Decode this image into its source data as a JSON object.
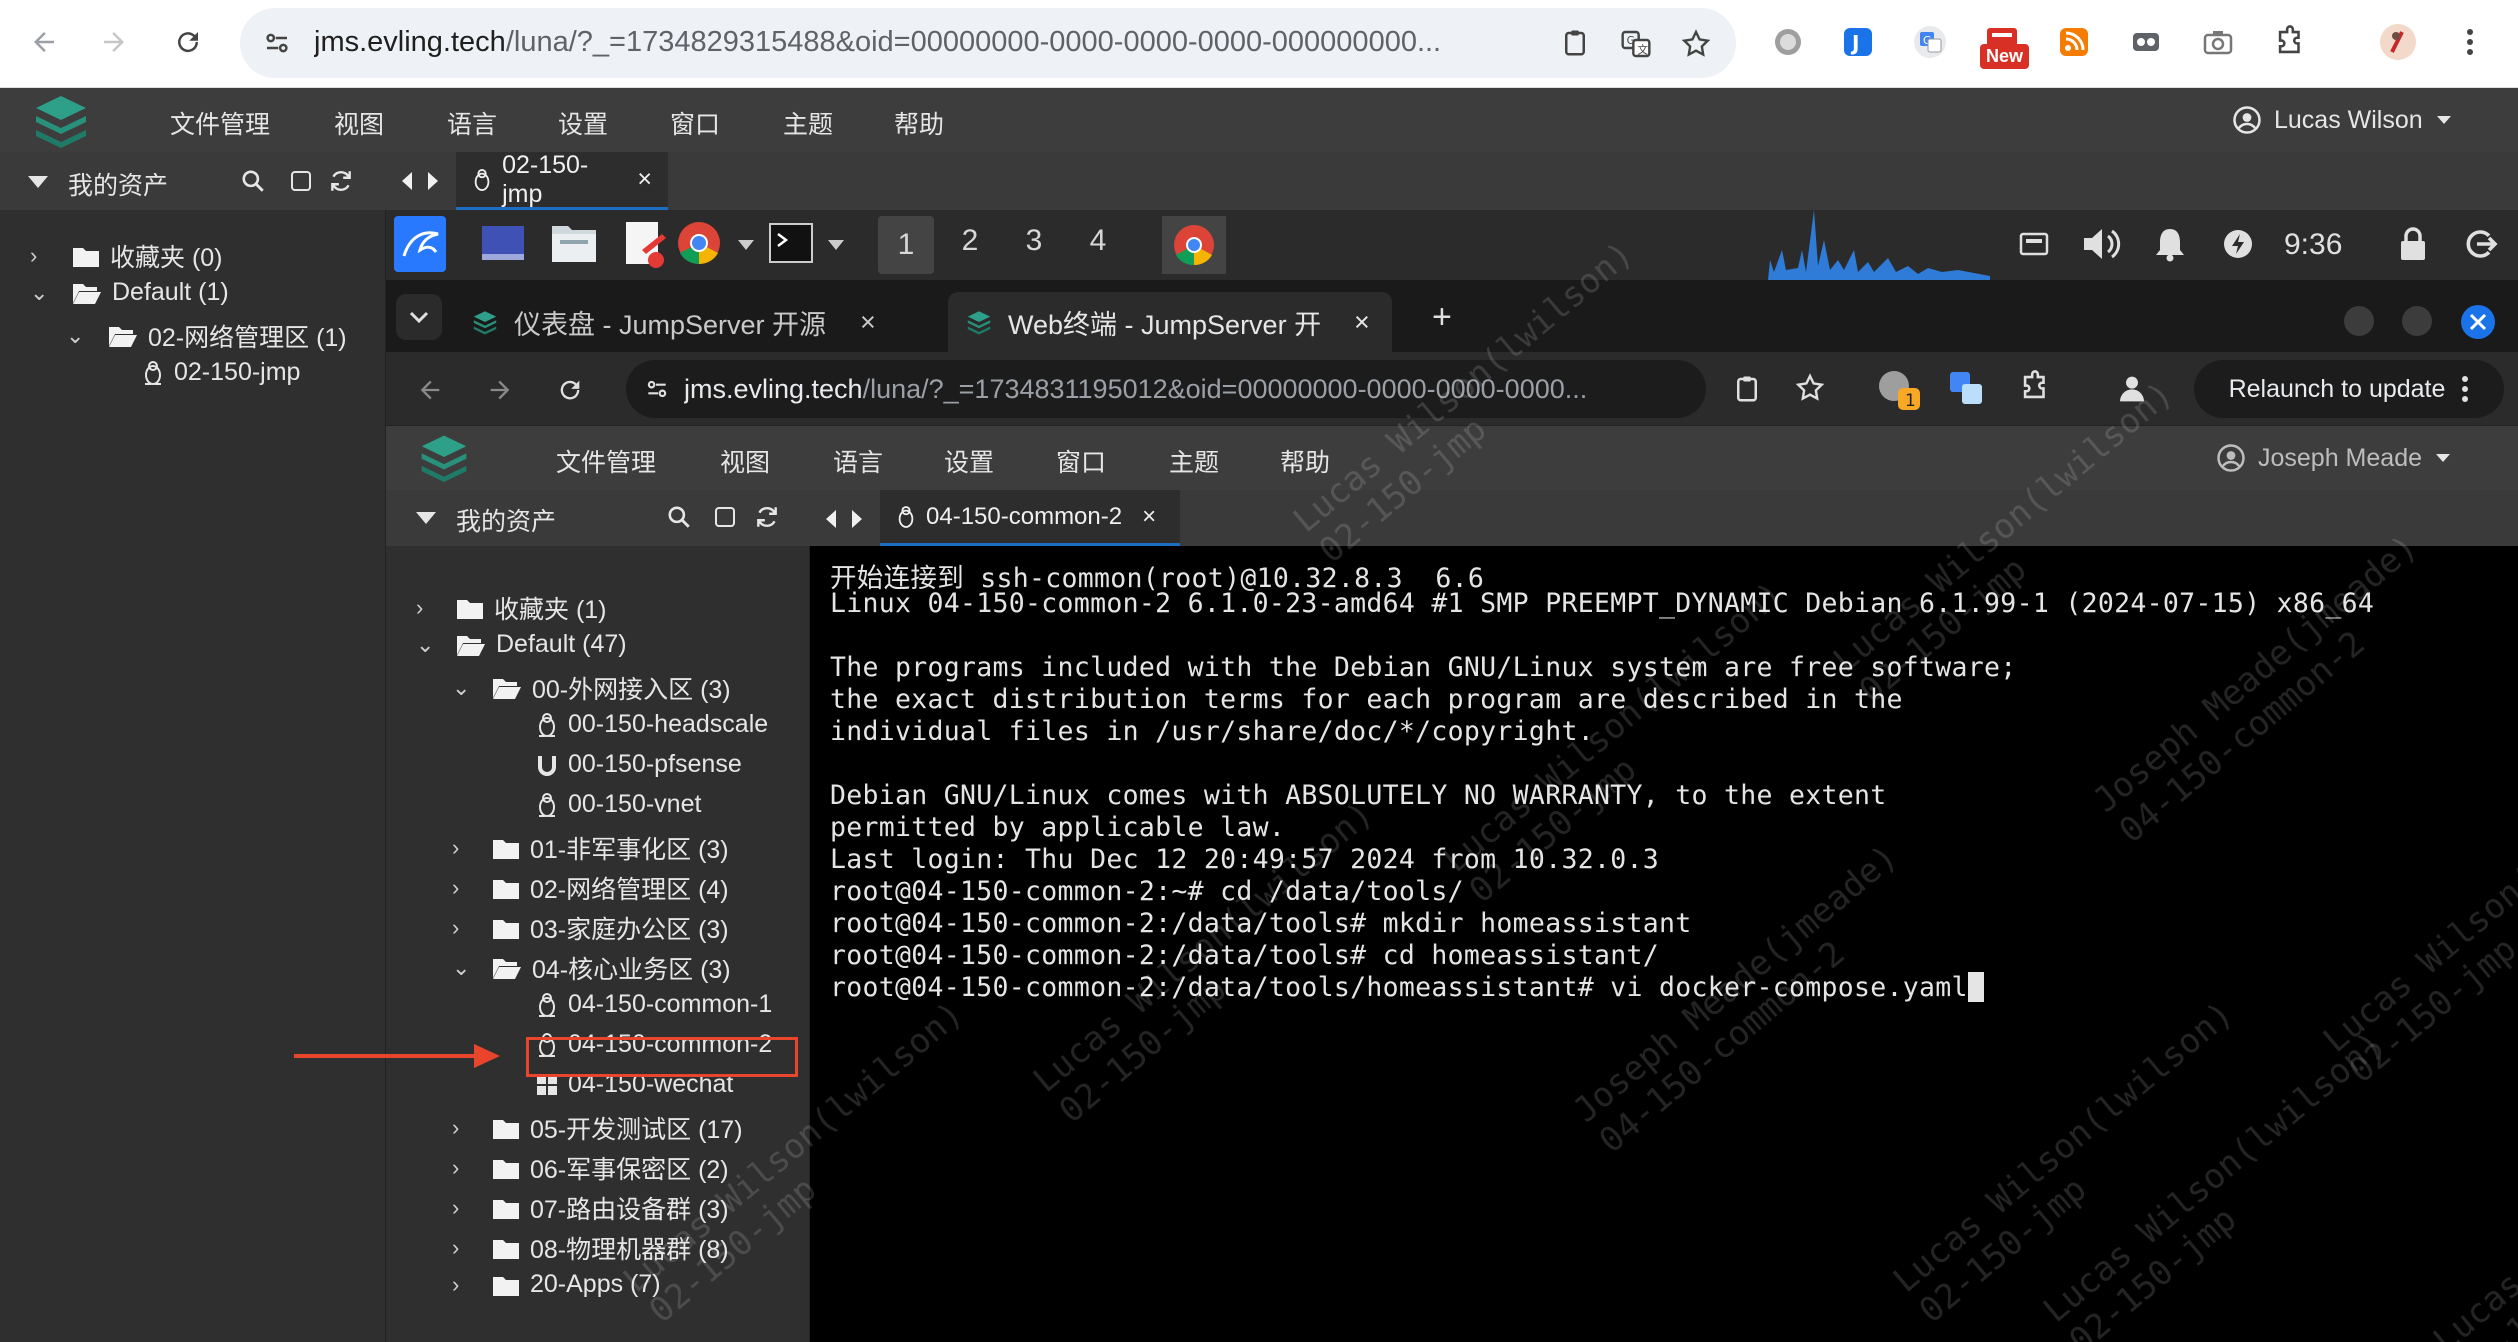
{
  "browser": {
    "url_host": "jms.evling.tech",
    "url_path": "/luna/?_=1734829315488&oid=00000000-0000-0000-0000-000000000...",
    "new_badge": "New"
  },
  "jumpserver": {
    "menu": [
      "文件管理",
      "视图",
      "语言",
      "设置",
      "窗口",
      "主题",
      "帮助"
    ],
    "user": "Lucas Wilson",
    "sidebar_title": "我的资产",
    "tree": [
      {
        "label": "收藏夹 (0)"
      },
      {
        "label": "Default (1)"
      },
      {
        "label": "02-网络管理区 (1)"
      },
      {
        "label": "02-150-jmp"
      }
    ],
    "tab_label": "02-150-jmp",
    "tab_close": "×"
  },
  "remote": {
    "workspaces": [
      "1",
      "2",
      "3",
      "4"
    ],
    "clock": "9:36",
    "inner_browser": {
      "tabs": [
        {
          "label": "仪表盘 - JumpServer 开源"
        },
        {
          "label": "Web终端 - JumpServer 开"
        }
      ],
      "tab_close": "×",
      "new_tab": "+",
      "url_host": "jms.evling.tech",
      "url_path": "/luna/?_=1734831195012&oid=00000000-0000-0000-0000...",
      "ext_badge": "1",
      "relaunch": "Relaunch to update"
    },
    "inner_jumpserver": {
      "menu": [
        "文件管理",
        "视图",
        "语言",
        "设置",
        "窗口",
        "主题",
        "帮助"
      ],
      "user": "Joseph Meade",
      "sidebar_title": "我的资产",
      "tab_label": "04-150-common-2",
      "tab_close": "×",
      "tree": [
        {
          "label": "收藏夹 (1)"
        },
        {
          "label": "Default (47)"
        },
        {
          "label": "00-外网接入区 (3)"
        },
        {
          "label": "00-150-headscale"
        },
        {
          "label": "00-150-pfsense"
        },
        {
          "label": "00-150-vnet"
        },
        {
          "label": "01-非军事化区 (3)"
        },
        {
          "label": "02-网络管理区 (4)"
        },
        {
          "label": "03-家庭办公区 (3)"
        },
        {
          "label": "04-核心业务区 (3)"
        },
        {
          "label": "04-150-common-1"
        },
        {
          "label": "04-150-common-2"
        },
        {
          "label": "04-150-wechat"
        },
        {
          "label": "05-开发测试区 (17)"
        },
        {
          "label": "06-军事保密区 (2)"
        },
        {
          "label": "07-路由设备群 (3)"
        },
        {
          "label": "08-物理机器群 (8)"
        },
        {
          "label": "20-Apps (7)"
        }
      ],
      "terminal_lines": [
        "开始连接到 ssh-common(root)@10.32.8.3  6.6",
        "Linux 04-150-common-2 6.1.0-23-amd64 #1 SMP PREEMPT_DYNAMIC Debian 6.1.99-1 (2024-07-15) x86_64",
        "",
        "The programs included with the Debian GNU/Linux system are free software;",
        "the exact distribution terms for each program are described in the",
        "individual files in /usr/share/doc/*/copyright.",
        "",
        "Debian GNU/Linux comes with ABSOLUTELY NO WARRANTY, to the extent",
        "permitted by applicable law.",
        "Last login: Thu Dec 12 20:49:57 2024 from 10.32.0.3",
        "root@04-150-common-2:~# cd /data/tools/",
        "root@04-150-common-2:/data/tools# mkdir homeassistant",
        "root@04-150-common-2:/data/tools# cd homeassistant/",
        "root@04-150-common-2:/data/tools/homeassistant# vi docker-compose.yaml"
      ],
      "watermarks": [
        "Lucas Wilson(lwilson)\n02-150-jmp",
        "Joseph Meade(jmeade)\n04-150-common-2"
      ]
    }
  },
  "colors": {
    "accent_blue": "#1b6ec2",
    "highlight_red": "#e8452c",
    "menubar": "#3d3d3d",
    "sidebar": "#2f2f2f",
    "terminal_bg": "#000000"
  }
}
